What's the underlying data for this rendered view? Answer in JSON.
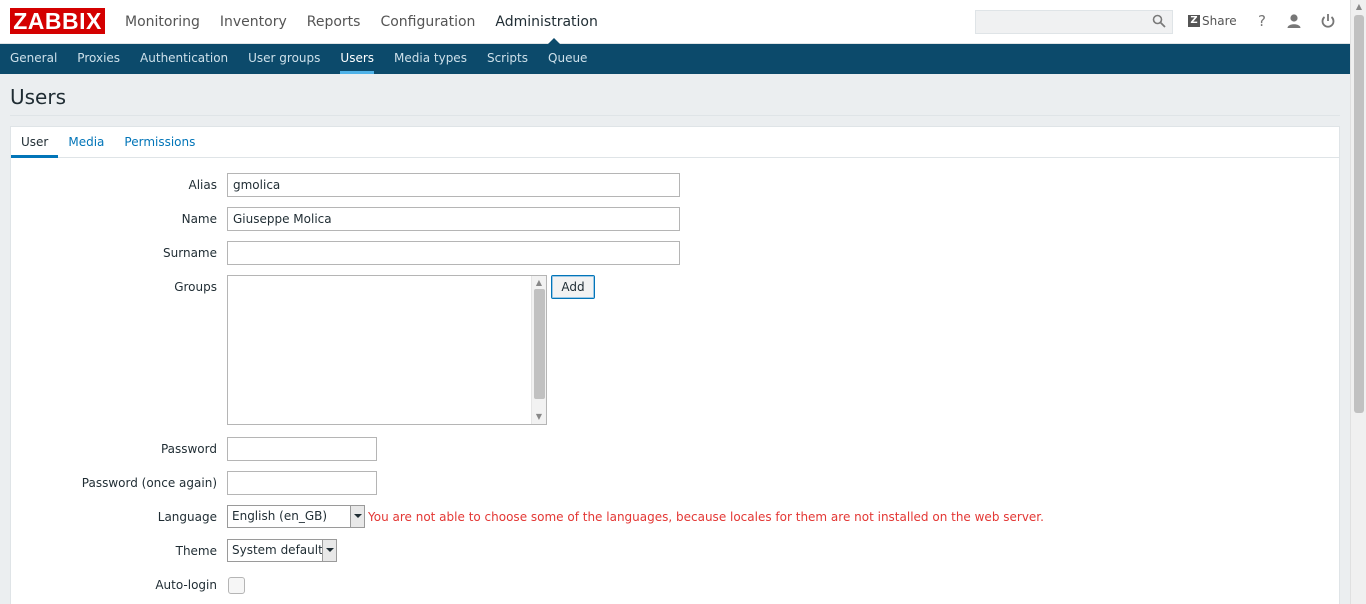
{
  "app": {
    "logo": "ZABBIX"
  },
  "main_menu": [
    {
      "label": "Monitoring"
    },
    {
      "label": "Inventory"
    },
    {
      "label": "Reports"
    },
    {
      "label": "Configuration"
    },
    {
      "label": "Administration",
      "active": true
    }
  ],
  "topbar": {
    "search_value": "",
    "share_label": "Share",
    "help_label": "?"
  },
  "sub_menu": [
    {
      "label": "General"
    },
    {
      "label": "Proxies"
    },
    {
      "label": "Authentication"
    },
    {
      "label": "User groups"
    },
    {
      "label": "Users",
      "active": true
    },
    {
      "label": "Media types"
    },
    {
      "label": "Scripts"
    },
    {
      "label": "Queue"
    }
  ],
  "page": {
    "title": "Users"
  },
  "tabs": [
    {
      "label": "User",
      "active": true
    },
    {
      "label": "Media"
    },
    {
      "label": "Permissions"
    }
  ],
  "form": {
    "alias": {
      "label": "Alias",
      "value": "gmolica"
    },
    "name": {
      "label": "Name",
      "value": "Giuseppe Molica"
    },
    "surname": {
      "label": "Surname",
      "value": ""
    },
    "groups": {
      "label": "Groups",
      "add_button": "Add"
    },
    "password": {
      "label": "Password",
      "value": ""
    },
    "password_again": {
      "label": "Password (once again)",
      "value": ""
    },
    "language": {
      "label": "Language",
      "value": "English (en_GB)",
      "warning": "You are not able to choose some of the languages, because locales for them are not installed on the web server."
    },
    "theme": {
      "label": "Theme",
      "value": "System default"
    },
    "autologin": {
      "label": "Auto-login",
      "checked": false
    }
  },
  "colors": {
    "brand": "#d40000",
    "subnav_bg": "#0c4a6b",
    "link": "#0275b8",
    "warning": "#e33734"
  }
}
